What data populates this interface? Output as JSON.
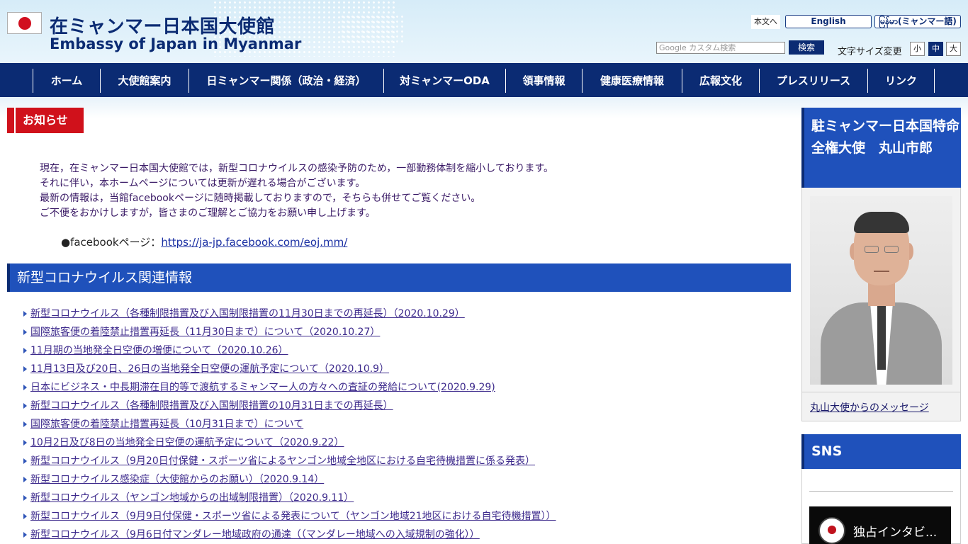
{
  "header": {
    "title_jp": "在ミャンマー日本国大使館",
    "title_en": "Embassy of Japan in Myanmar",
    "skip_link": "本文へ",
    "lang_english": "English",
    "lang_myanmar": "မြန်မာ(ミャンマー語)",
    "search_placeholder": "Google カスタム検索",
    "search_button": "検索",
    "font_size_label": "文字サイズ変更",
    "font_small": "小",
    "font_medium": "中",
    "font_large": "大"
  },
  "nav": {
    "items": [
      {
        "label": "ホーム"
      },
      {
        "label": "大使館案内"
      },
      {
        "label": "日ミャンマー関係（政治・経済）"
      },
      {
        "label": "対ミャンマーODA"
      },
      {
        "label": "領事情報"
      },
      {
        "label": "健康医療情報"
      },
      {
        "label": "広報文化"
      },
      {
        "label": "プレスリリース"
      },
      {
        "label": "リンク"
      }
    ]
  },
  "notice": {
    "heading": "お知らせ",
    "lines": [
      "現在，在ミャンマー日本国大使館では，新型コロナウイルスの感染予防のため，一部勤務体制を縮小しております。",
      "それに伴い，本ホームページについては更新が遅れる場合がございます。",
      "最新の情報は，当館facebookページに随時掲載しておりますので，そちらも併せてご覧ください。",
      "ご不便をおかけしますが，皆さまのご理解とご協力をお願い申し上げます。"
    ],
    "fb_label": "●facebookページ：",
    "fb_url": "https://ja-jp.facebook.com/eoj.mm/"
  },
  "covid": {
    "heading": "新型コロナウイルス関連情報",
    "items": [
      "新型コロナウイルス（各種制限措置及び入国制限措置の11月30日までの再延長）（2020.10.29）",
      "国際旅客便の着陸禁止措置再延長（11月30日まで）について（2020.10.27）",
      "11月期の当地発全日空便の増便について（2020.10.26）",
      "11月13日及び20日、26日の当地発全日空便の運航予定について（2020.10.9）",
      "日本にビジネス・中長期滞在目的等で渡航するミャンマー人の方々への査証の発給について(2020.9.29)",
      "新型コロナウイルス（各種制限措置及び入国制限措置の10月31日までの再延長）",
      "国際旅客便の着陸禁止措置再延長（10月31日まで）について",
      "10月2日及び8日の当地発全日空便の運航予定について（2020.9.22）",
      "新型コロナウイルス（9月20日付保健・スポーツ省によるヤンゴン地域全地区における自宅待機措置に係る発表）",
      "新型コロナウイルス感染症（大使館からのお願い）（2020.9.14）",
      "新型コロナウイルス（ヤンゴン地域からの出域制限措置）（2020.9.11）",
      "新型コロナウイルス（9月9日付保健・スポーツ省による発表について（ヤンゴン地域21地区における自宅待機措置））",
      "新型コロナウイルス（9月6日付マンダレー地域政府の通達（（マンダレー地域への入域規制の強化））"
    ]
  },
  "sidebar": {
    "ambassador_heading": "駐ミャンマー日本国特命全権大使　丸山市郎",
    "ambassador_link": "丸山大使からのメッセージ",
    "sns_heading": "SNS",
    "video_title": "独占インタビ..."
  }
}
